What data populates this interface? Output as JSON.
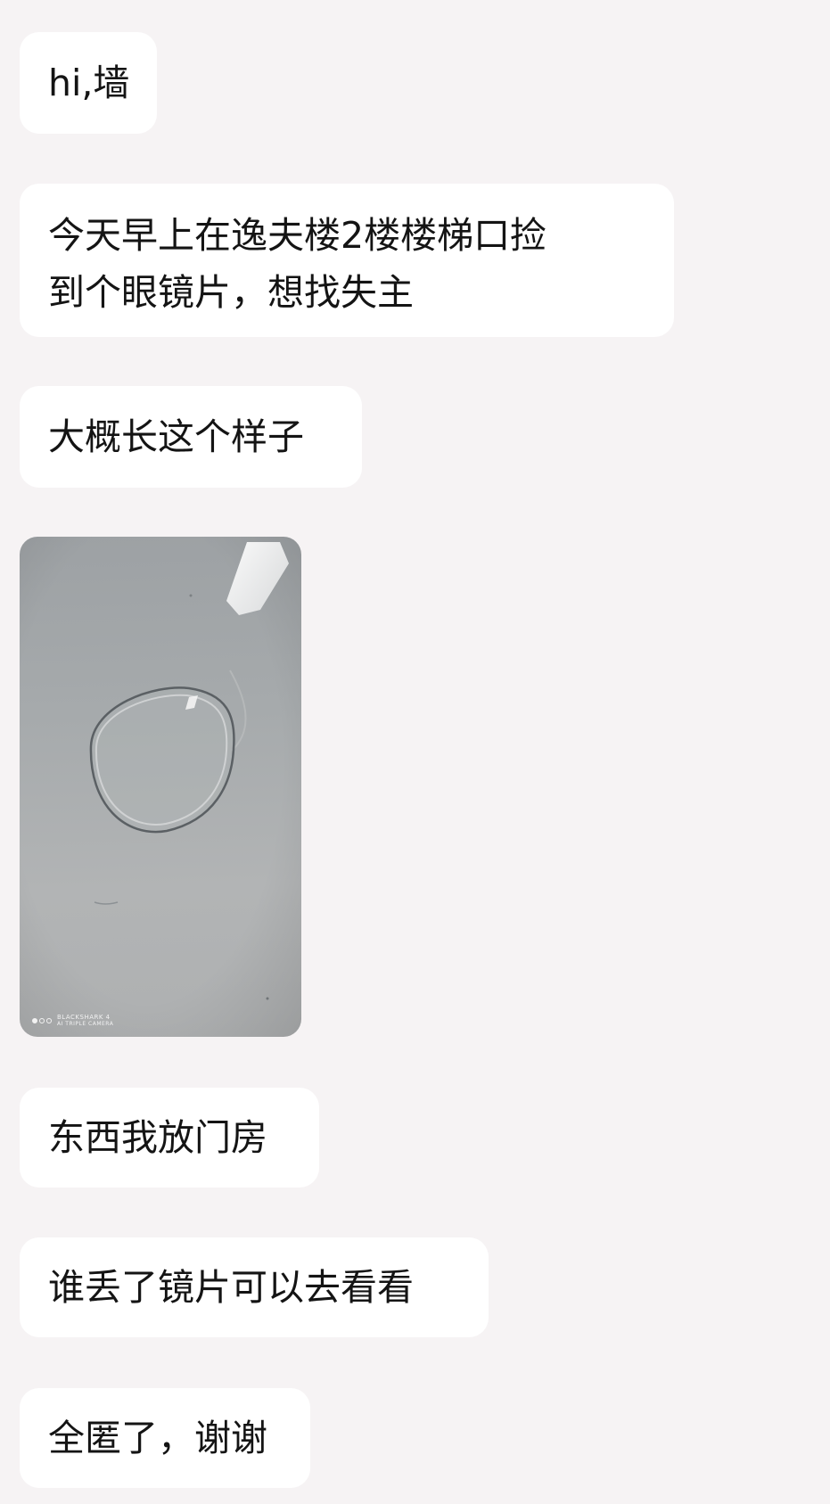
{
  "messages": [
    {
      "text": "hi,墙"
    },
    {
      "line1": "今天早上在逸夫楼2楼楼梯口捡",
      "line2": "到个眼镜片，想找失主"
    },
    {
      "text": "大概长这个样子"
    },
    {
      "photo": {
        "watermark_line1": "BLACKSHARK 4",
        "watermark_line2": "AI TRIPLE CAMERA"
      }
    },
    {
      "text": "东西我放门房"
    },
    {
      "text": "谁丢了镜片可以去看看"
    },
    {
      "text": "全匿了，谢谢"
    }
  ],
  "colors": {
    "background": "#f6f3f4",
    "bubble": "#ffffff",
    "text": "#141414"
  }
}
